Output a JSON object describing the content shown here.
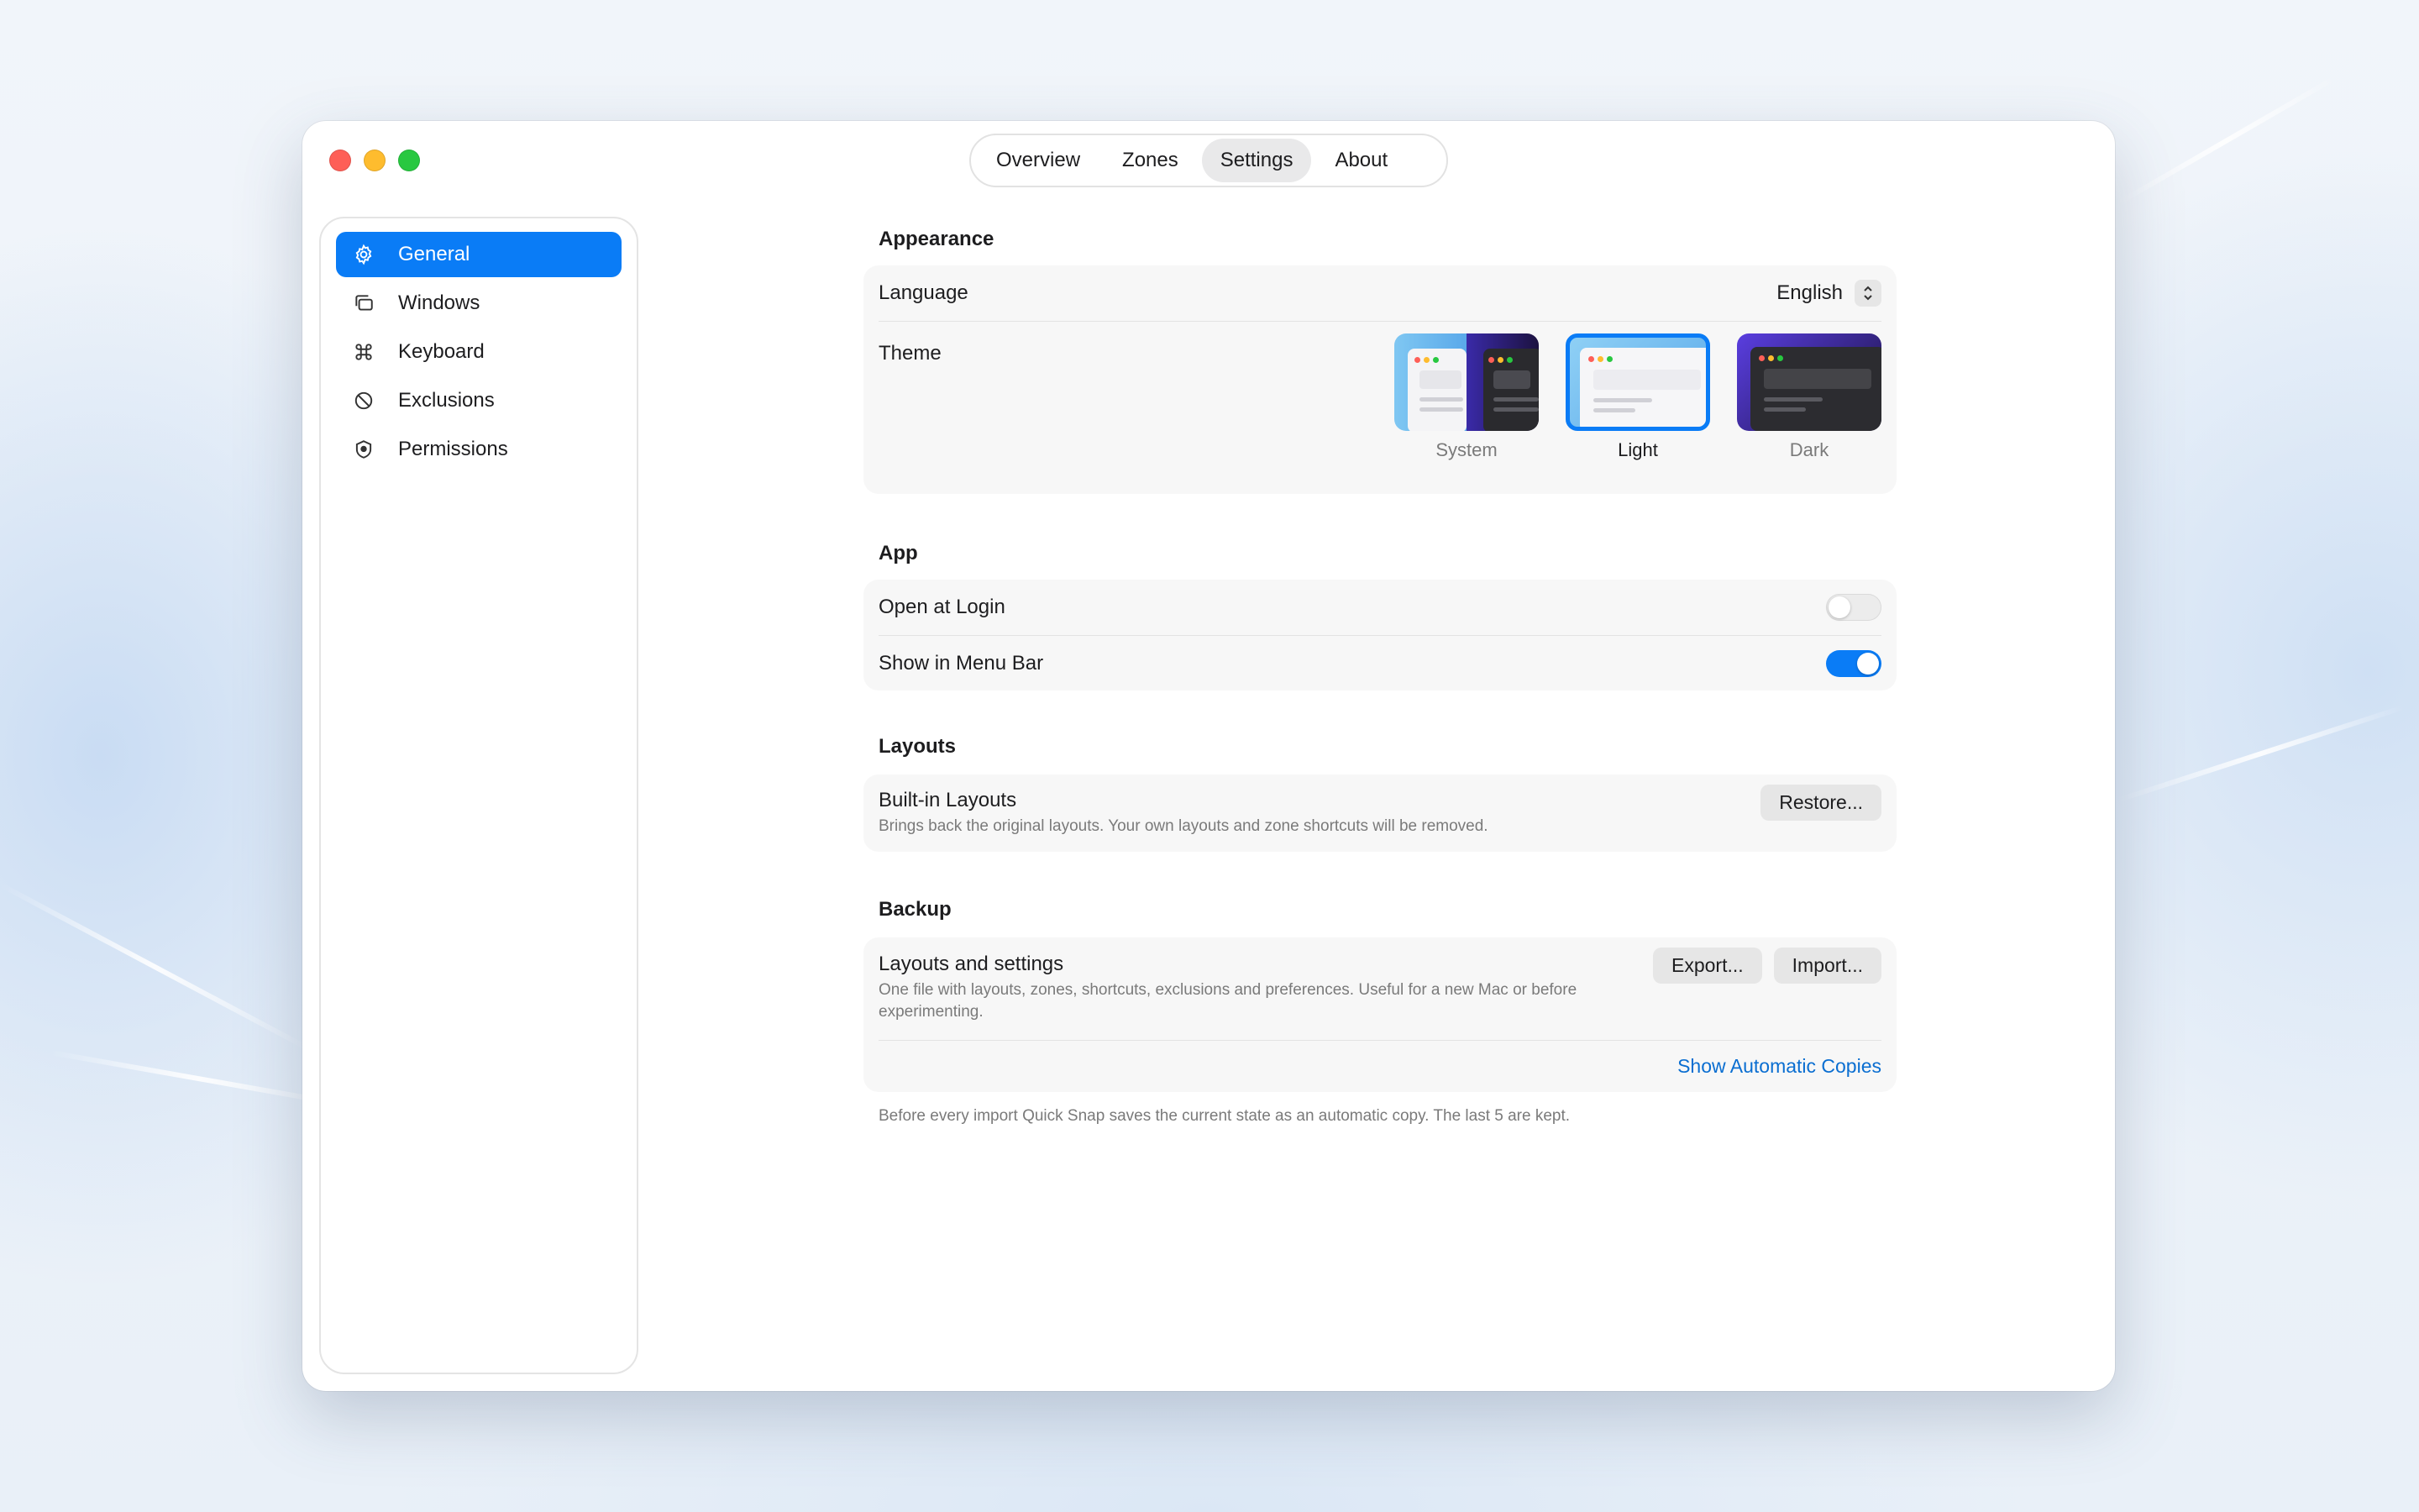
{
  "window": {
    "tabs": [
      {
        "label": "Overview",
        "active": false
      },
      {
        "label": "Zones",
        "active": false
      },
      {
        "label": "Settings",
        "active": true
      },
      {
        "label": "About",
        "active": false
      }
    ]
  },
  "sidebar": {
    "items": [
      {
        "label": "General",
        "icon": "gear-icon",
        "active": true
      },
      {
        "label": "Windows",
        "icon": "windows-icon",
        "active": false
      },
      {
        "label": "Keyboard",
        "icon": "command-icon",
        "active": false
      },
      {
        "label": "Exclusions",
        "icon": "prohibited-icon",
        "active": false
      },
      {
        "label": "Permissions",
        "icon": "shield-icon",
        "active": false
      }
    ]
  },
  "appearance": {
    "title": "Appearance",
    "language_label": "Language",
    "language_value": "English",
    "theme_label": "Theme",
    "themes": [
      {
        "label": "System",
        "selected": false
      },
      {
        "label": "Light",
        "selected": true
      },
      {
        "label": "Dark",
        "selected": false
      }
    ]
  },
  "app": {
    "title": "App",
    "open_at_login_label": "Open at Login",
    "open_at_login": false,
    "show_in_menu_bar_label": "Show in Menu Bar",
    "show_in_menu_bar": true
  },
  "layouts": {
    "title": "Layouts",
    "builtin_label": "Built-in Layouts",
    "builtin_desc": "Brings back the original layouts. Your own layouts and zone shortcuts will be removed.",
    "restore_button": "Restore..."
  },
  "backup": {
    "title": "Backup",
    "label": "Layouts and settings",
    "desc": "One file with layouts, zones, shortcuts, exclusions and preferences. Useful for a new Mac or before experimenting.",
    "export_button": "Export...",
    "import_button": "Import...",
    "show_copies_link": "Show Automatic Copies",
    "footnote": "Before every import Quick Snap saves the current state as an automatic copy. The last 5 are kept."
  },
  "colors": {
    "accent": "#0a7cf6",
    "link": "#0a6ed1",
    "traffic_red": "#fe5f57",
    "traffic_yellow": "#febc2e",
    "traffic_green": "#28c840"
  }
}
